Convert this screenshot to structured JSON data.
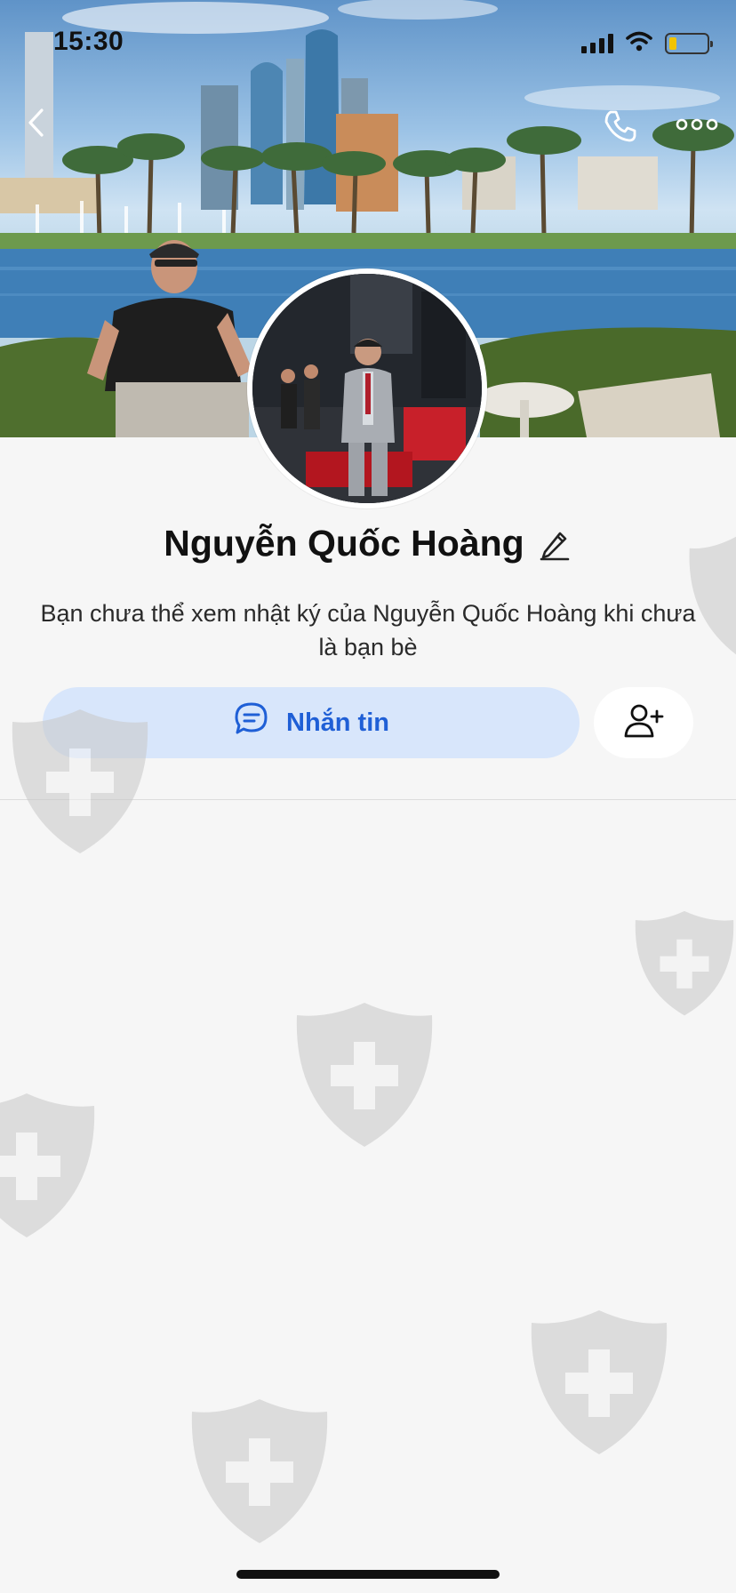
{
  "status_bar": {
    "time": "15:30",
    "icons": [
      "cellular-signal-icon",
      "wifi-icon",
      "battery-icon"
    ],
    "battery_level": 0.2,
    "battery_color": "#f2c400"
  },
  "header": {
    "back_icon": "chevron-left-icon",
    "call_icon": "phone-icon",
    "more_icon": "more-horizontal-icon"
  },
  "profile": {
    "name": "Nguyễn Quốc Hoàng",
    "bio": "Bạn chưa thể xem nhật ký của Nguyễn Quốc Hoàng khi chưa là bạn bè",
    "edit_icon": "pencil-icon"
  },
  "actions": {
    "message_label": "Nhắn tin",
    "message_icon": "chat-bubble-icon",
    "add_friend_icon": "add-friend-icon"
  },
  "colors": {
    "accent": "#1f5fd6",
    "message_button_bg": "#d8e6fb",
    "page_bg": "#f6f6f6"
  }
}
